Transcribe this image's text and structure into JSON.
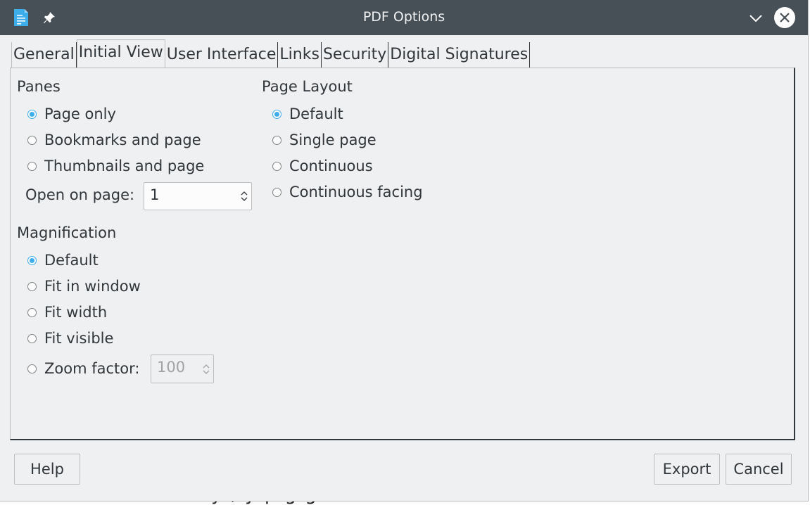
{
  "window": {
    "title": "PDF Options"
  },
  "background_text": "y , y  p g g",
  "tabs": [
    {
      "label": "General"
    },
    {
      "label": "Initial View"
    },
    {
      "label": "User Interface"
    },
    {
      "label": "Links"
    },
    {
      "label": "Security"
    },
    {
      "label": "Digital Signatures"
    }
  ],
  "active_tab": "Initial View",
  "panes": {
    "title": "Panes",
    "options": [
      {
        "label": "Page only",
        "checked": true
      },
      {
        "label": "Bookmarks and page",
        "checked": false
      },
      {
        "label": "Thumbnails and page",
        "checked": false
      }
    ],
    "open_on_page_label": "Open on page:",
    "open_on_page_value": "1"
  },
  "page_layout": {
    "title": "Page Layout",
    "options": [
      {
        "label": "Default",
        "checked": true
      },
      {
        "label": "Single page",
        "checked": false
      },
      {
        "label": "Continuous",
        "checked": false
      },
      {
        "label": "Continuous facing",
        "checked": false
      }
    ]
  },
  "magnification": {
    "title": "Magnification",
    "options": [
      {
        "label": "Default",
        "checked": true
      },
      {
        "label": "Fit in window",
        "checked": false
      },
      {
        "label": "Fit width",
        "checked": false
      },
      {
        "label": "Fit visible",
        "checked": false
      },
      {
        "label": "Zoom factor:",
        "checked": false
      }
    ],
    "zoom_value": "100"
  },
  "buttons": {
    "help": "Help",
    "export": "Export",
    "cancel": "Cancel"
  },
  "colors": {
    "titlebar": "#475057",
    "accent": "#3daee9",
    "window_bg": "#eff0f1"
  }
}
